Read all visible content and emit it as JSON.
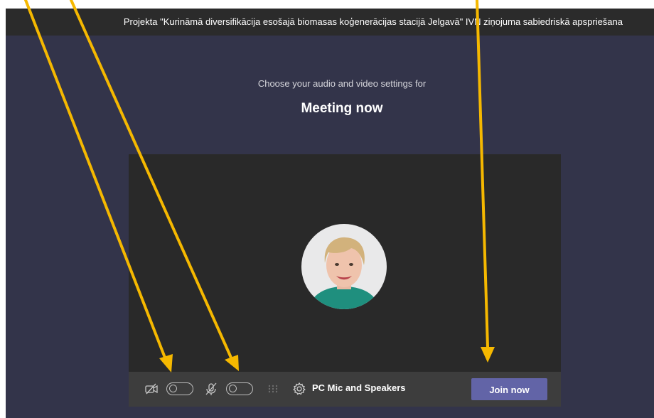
{
  "window": {
    "title": "Projekta \"Kurināmā diversifikācija esošajā biomasas koģenerācijas stacijā Jelgavā\" IVN ziņojuma sabiedriskā apspriešana"
  },
  "prejoin": {
    "subtitle": "Choose your audio and video settings for",
    "meeting_name": "Meeting now"
  },
  "controls": {
    "camera_icon": "camera-off-icon",
    "mic_icon": "mic-off-icon",
    "blur_icon": "background-blur-icon",
    "settings_icon": "gear-icon",
    "camera_toggle_on": false,
    "mic_toggle_on": false,
    "device_label": "PC Mic and Speakers",
    "join_label": "Join now"
  },
  "colors": {
    "background": "#33344a",
    "title_bar": "#2b2b2b",
    "preview": "#292929",
    "controls_bar": "#3d3d3d",
    "join_button": "#6264a7",
    "annotation_arrows": "#f5b800"
  }
}
